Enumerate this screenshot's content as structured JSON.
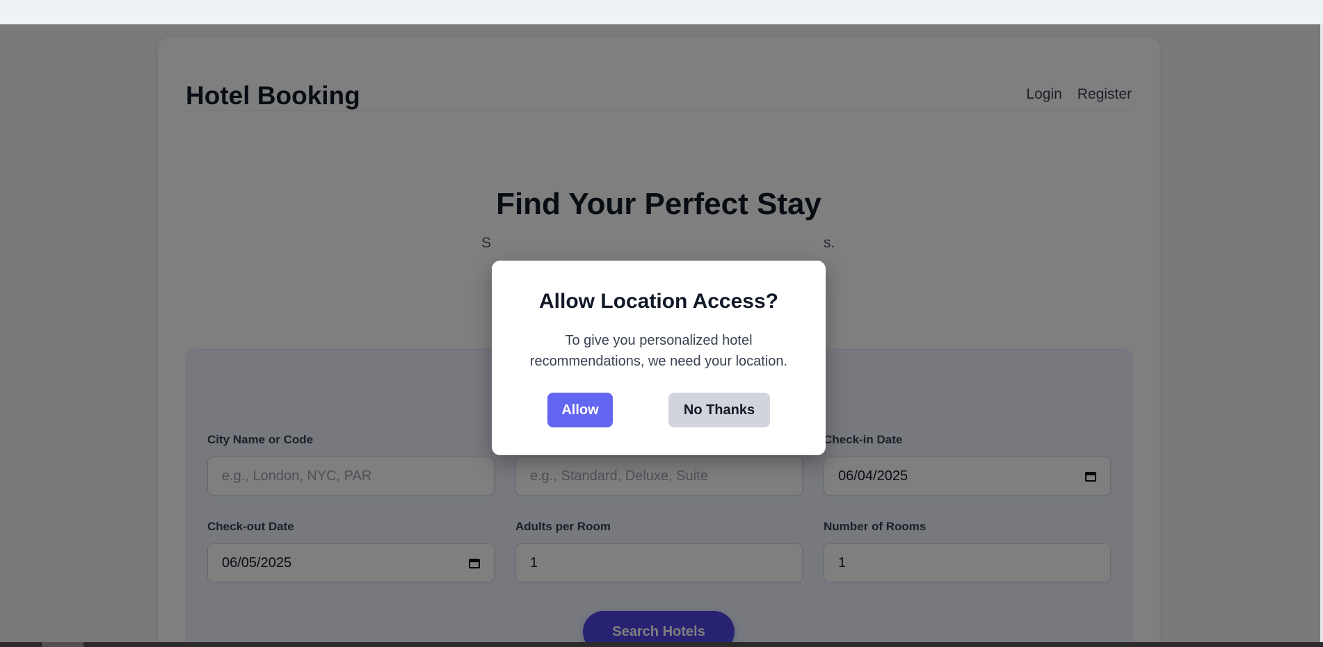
{
  "header": {
    "brand": "Hotel Booking",
    "nav": {
      "login": "Login",
      "register": "Register"
    }
  },
  "hero": {
    "title": "Find Your Perfect Stay",
    "subtitle_left": "S",
    "subtitle_right": "s."
  },
  "search": {
    "city": {
      "label": "City Name or Code",
      "placeholder": "e.g., London, NYC, PAR"
    },
    "room_type": {
      "label": "",
      "placeholder": "e.g., Standard, Deluxe, Suite"
    },
    "checkin": {
      "label": "Check-in Date",
      "value": "06/04/2025"
    },
    "checkout": {
      "label": "Check-out Date",
      "value": "06/05/2025"
    },
    "adults": {
      "label": "Adults per Room",
      "value": "1"
    },
    "rooms": {
      "label": "Number of Rooms",
      "value": "1"
    },
    "submit_label": "Search Hotels"
  },
  "modal": {
    "title": "Allow Location Access?",
    "text": "To give you personalized hotel recommendations, we need your location.",
    "allow_label": "Allow",
    "decline_label": "No Thanks"
  },
  "colors": {
    "primary": "#4f46e5",
    "allow_button": "#6366f1",
    "overlay": "rgba(0,0,0,0.5)"
  },
  "icons": {
    "date": "calendar-icon"
  }
}
